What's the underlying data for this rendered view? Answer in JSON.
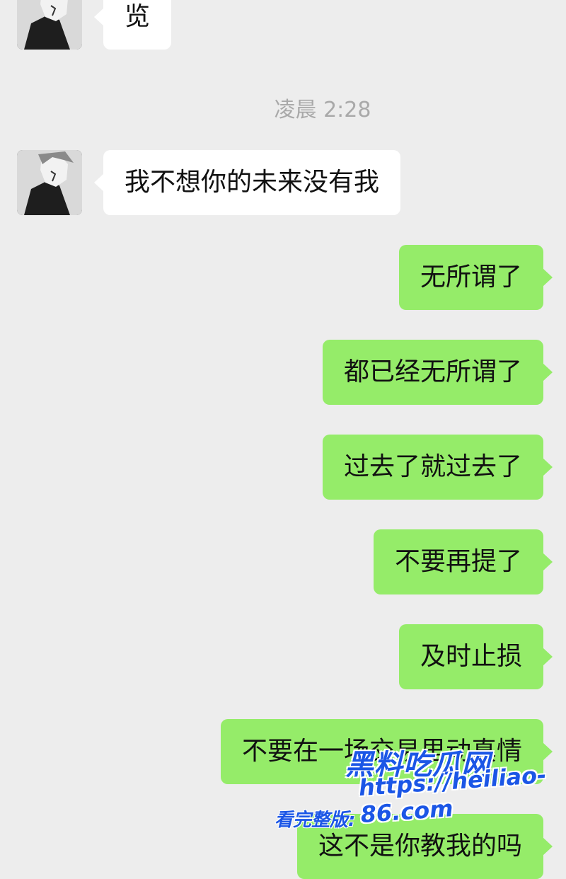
{
  "chat": {
    "timestamp": "凌晨 2:28",
    "messages": [
      {
        "side": "in",
        "text": "览"
      },
      {
        "side": "in",
        "text": "我不想你的未来没有我"
      },
      {
        "side": "out",
        "text": "无所谓了"
      },
      {
        "side": "out",
        "text": "都已经无所谓了"
      },
      {
        "side": "out",
        "text": "过去了就过去了"
      },
      {
        "side": "out",
        "text": "不要再提了"
      },
      {
        "side": "out",
        "text": "及时止损"
      },
      {
        "side": "out",
        "text": "不要在一场交易里动真情"
      },
      {
        "side": "out",
        "text": "这不是你教我的吗"
      }
    ]
  },
  "contact": {
    "avatar_icon": "anime-character-avatar-icon"
  },
  "watermark": {
    "title": "黑料吃瓜网",
    "label": "看完整版:",
    "url": "https://heiliao-86.com"
  },
  "colors": {
    "background": "#ededed",
    "incoming_bubble": "#ffffff",
    "outgoing_bubble": "#95ec69",
    "timestamp_text": "#a9a9a9",
    "watermark": "#1b56e6"
  }
}
